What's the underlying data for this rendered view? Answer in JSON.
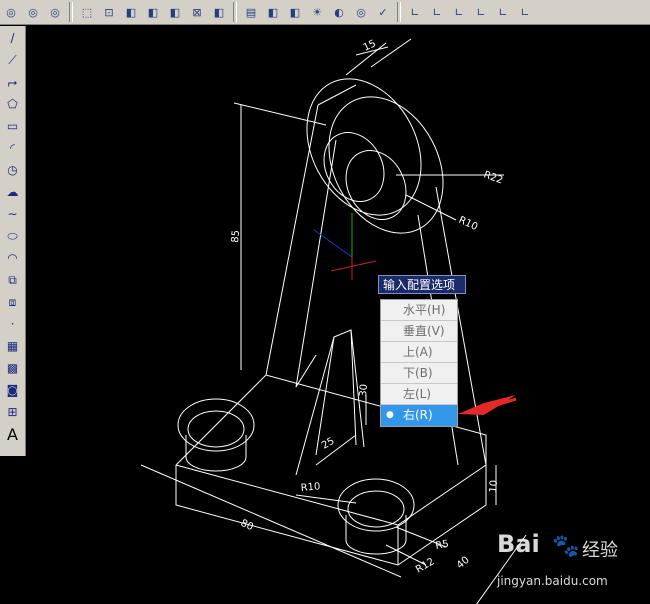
{
  "toolbar": {
    "icons": [
      "orbit-icon",
      "orbit-icon",
      "orbit-icon",
      "box-icon",
      "view-icon",
      "cube-icon",
      "cube-icon",
      "cube-icon",
      "render-icon",
      "cube-icon",
      "layer-icon",
      "cube-icon",
      "cube-icon",
      "light-icon",
      "material-icon",
      "orbit-icon",
      "check-icon",
      "ucs-icon",
      "ucs-icon",
      "ucs-icon",
      "ucs-icon",
      "ucs-icon",
      "ucs-icon"
    ]
  },
  "left_toolbar": {
    "tools": [
      {
        "name": "line-icon",
        "glyph": "/"
      },
      {
        "name": "construction-line-icon",
        "glyph": "⟋"
      },
      {
        "name": "polyline-icon",
        "glyph": "⮣"
      },
      {
        "name": "polygon-icon",
        "glyph": "⬠"
      },
      {
        "name": "rectangle-icon",
        "glyph": "▭"
      },
      {
        "name": "arc-icon",
        "glyph": "◜"
      },
      {
        "name": "circle-icon",
        "glyph": "◷"
      },
      {
        "name": "revision-cloud-icon",
        "glyph": "☁"
      },
      {
        "name": "spline-icon",
        "glyph": "∼"
      },
      {
        "name": "ellipse-icon",
        "glyph": "⬭"
      },
      {
        "name": "ellipse-arc-icon",
        "glyph": "◠"
      },
      {
        "name": "insert-block-icon",
        "glyph": "⧉"
      },
      {
        "name": "make-block-icon",
        "glyph": "⧈"
      },
      {
        "name": "point-icon",
        "glyph": "·"
      },
      {
        "name": "hatch-icon",
        "glyph": "▦"
      },
      {
        "name": "gradient-icon",
        "glyph": "▩"
      },
      {
        "name": "region-icon",
        "glyph": "◙"
      },
      {
        "name": "table-icon",
        "glyph": "⊞"
      },
      {
        "name": "multiline-text-icon",
        "glyph": "A"
      }
    ]
  },
  "dimensions": {
    "d15": "15",
    "r22": "R22",
    "r10_top": "R10",
    "d85": "85",
    "d30": "30",
    "d25": "25",
    "r10_bottom": "R10",
    "d80": "80",
    "d10": "10",
    "r5": "R5",
    "r12": "R12",
    "d40": "40"
  },
  "popup": {
    "title": "输入配置选项",
    "items": [
      {
        "label": "水平(H)",
        "selected": false
      },
      {
        "label": "垂直(V)",
        "selected": false
      },
      {
        "label": "上(A)",
        "selected": false
      },
      {
        "label": "下(B)",
        "selected": false
      },
      {
        "label": "左(L)",
        "selected": false
      },
      {
        "label": "右(R)",
        "selected": true
      }
    ]
  },
  "watermark": {
    "logo": "Bai",
    "brand": "经验",
    "url": "jingyan.baidu.com"
  },
  "colors": {
    "canvas_bg": "#000000",
    "line": "#ffffff",
    "arrow": "#e62828",
    "axis_x": "#d02020",
    "axis_y": "#20b020",
    "axis_z": "#2030d0",
    "selected": "#3296ea"
  }
}
